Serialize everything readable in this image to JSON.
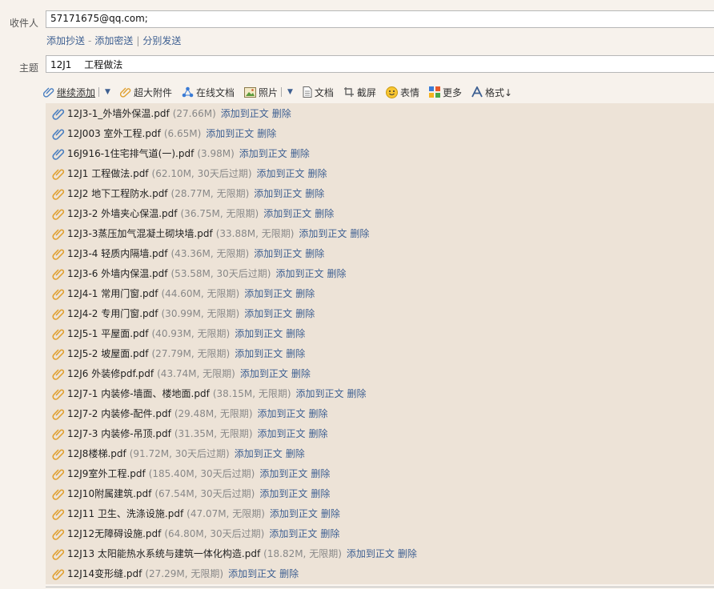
{
  "to": {
    "label": "收件人",
    "value": "57171675@qq.com;"
  },
  "cc_links": {
    "add_cc": "添加抄送",
    "dash": "-",
    "add_bcc": "添加密送",
    "bar": "|",
    "separate_send": "分别发送"
  },
  "subject": {
    "label": "主题",
    "value": "12J1　 工程做法"
  },
  "toolbar": {
    "continue_add": "继续添加",
    "large_attach": "超大附件",
    "online_doc": "在线文档",
    "photo": "照片",
    "doc": "文档",
    "screenshot": "截屏",
    "emoji": "表情",
    "more": "更多",
    "format": "格式↓"
  },
  "colors": {
    "link": "#3d5f91",
    "attach_bg": "#ede3d7",
    "page_bg": "#f7f2ec",
    "clip_blue": "#4a7fc1",
    "clip_orange": "#e0a030"
  },
  "attachments": [
    {
      "name": "12J3-1_外墙外保温.pdf",
      "meta": "(27.66M)",
      "add": "添加到正文",
      "del": "删除",
      "clip": "blue"
    },
    {
      "name": "12J003 室外工程.pdf",
      "meta": "(6.65M)",
      "add": "添加到正文",
      "del": "删除",
      "clip": "blue"
    },
    {
      "name": "16J916-1住宅排气道(一).pdf",
      "meta": "(3.98M)",
      "add": "添加到正文",
      "del": "删除",
      "clip": "blue"
    },
    {
      "name": "12J1 工程做法.pdf",
      "meta": "(62.10M, 30天后过期)",
      "add": "添加到正文",
      "del": "删除",
      "clip": "orange"
    },
    {
      "name": "12J2 地下工程防水.pdf",
      "meta": "(28.77M, 无限期)",
      "add": "添加到正文",
      "del": "删除",
      "clip": "orange"
    },
    {
      "name": "12J3-2 外墙夹心保温.pdf",
      "meta": "(36.75M, 无限期)",
      "add": "添加到正文",
      "del": "删除",
      "clip": "orange"
    },
    {
      "name": "12J3-3蒸压加气混凝土砌块墙.pdf",
      "meta": "(33.88M, 无限期)",
      "add": "添加到正文",
      "del": "删除",
      "clip": "orange"
    },
    {
      "name": "12J3-4 轻质内隔墙.pdf",
      "meta": "(43.36M, 无限期)",
      "add": "添加到正文",
      "del": "删除",
      "clip": "orange"
    },
    {
      "name": "12J3-6 外墙内保温.pdf",
      "meta": "(53.58M, 30天后过期)",
      "add": "添加到正文",
      "del": "删除",
      "clip": "orange"
    },
    {
      "name": "12J4-1 常用门窗.pdf",
      "meta": "(44.60M, 无限期)",
      "add": "添加到正文",
      "del": "删除",
      "clip": "orange"
    },
    {
      "name": "12J4-2 专用门窗.pdf",
      "meta": "(30.99M, 无限期)",
      "add": "添加到正文",
      "del": "删除",
      "clip": "orange"
    },
    {
      "name": "12J5-1 平屋面.pdf",
      "meta": "(40.93M, 无限期)",
      "add": "添加到正文",
      "del": "删除",
      "clip": "orange"
    },
    {
      "name": "12J5-2 坡屋面.pdf",
      "meta": "(27.79M, 无限期)",
      "add": "添加到正文",
      "del": "删除",
      "clip": "orange"
    },
    {
      "name": "12J6 外装修pdf.pdf",
      "meta": "(43.74M, 无限期)",
      "add": "添加到正文",
      "del": "删除",
      "clip": "orange"
    },
    {
      "name": "12J7-1 内装修-墙面、楼地面.pdf",
      "meta": "(38.15M, 无限期)",
      "add": "添加到正文",
      "del": "删除",
      "clip": "orange"
    },
    {
      "name": "12J7-2 内装修-配件.pdf",
      "meta": "(29.48M, 无限期)",
      "add": "添加到正文",
      "del": "删除",
      "clip": "orange"
    },
    {
      "name": "12J7-3 内装修-吊顶.pdf",
      "meta": "(31.35M, 无限期)",
      "add": "添加到正文",
      "del": "删除",
      "clip": "orange"
    },
    {
      "name": "12J8楼梯.pdf",
      "meta": "(91.72M, 30天后过期)",
      "add": "添加到正文",
      "del": "删除",
      "clip": "orange"
    },
    {
      "name": "12J9室外工程.pdf",
      "meta": "(185.40M, 30天后过期)",
      "add": "添加到正文",
      "del": "删除",
      "clip": "orange"
    },
    {
      "name": "12J10附属建筑.pdf",
      "meta": "(67.54M, 30天后过期)",
      "add": "添加到正文",
      "del": "删除",
      "clip": "orange"
    },
    {
      "name": "12J11 卫生、洗涤设施.pdf",
      "meta": "(47.07M, 无限期)",
      "add": "添加到正文",
      "del": "删除",
      "clip": "orange"
    },
    {
      "name": "12J12无障碍设施.pdf",
      "meta": "(64.80M, 30天后过期)",
      "add": "添加到正文",
      "del": "删除",
      "clip": "orange"
    },
    {
      "name": "12J13 太阳能热水系统与建筑一体化构造.pdf",
      "meta": "(18.82M, 无限期)",
      "add": "添加到正文",
      "del": "删除",
      "clip": "orange"
    },
    {
      "name": "12J14变形缝.pdf",
      "meta": "(27.29M, 无限期)",
      "add": "添加到正文",
      "del": "删除",
      "clip": "orange"
    }
  ]
}
